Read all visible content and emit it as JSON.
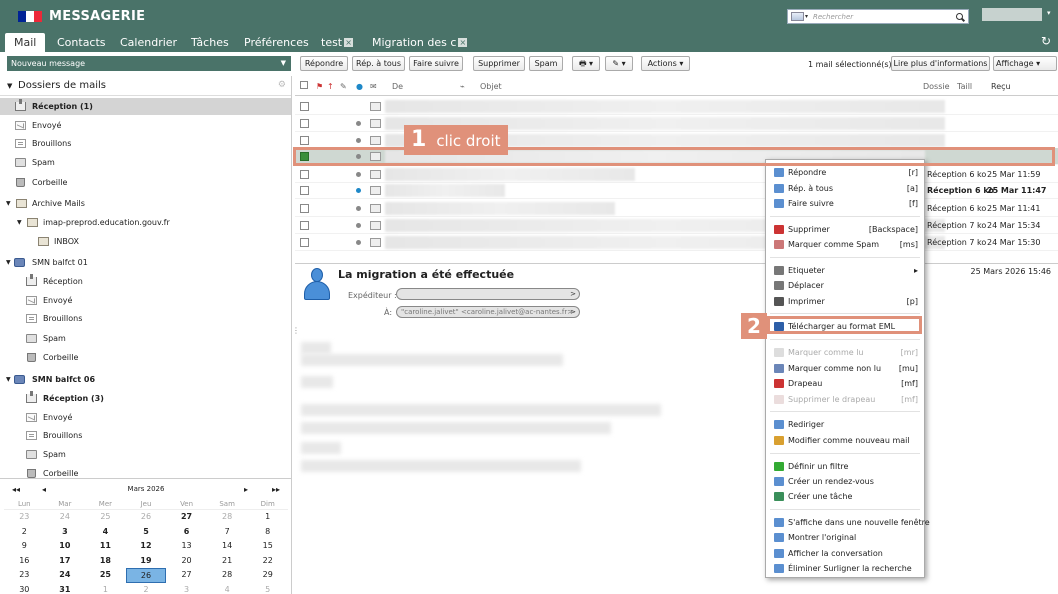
{
  "app": {
    "title": "MESSAGERIE",
    "flag_colors": [
      "#002395",
      "#ffffff",
      "#ed2939"
    ]
  },
  "search": {
    "placeholder": "Rechercher"
  },
  "tabs": [
    {
      "label": "Mail"
    },
    {
      "label": "Contacts"
    },
    {
      "label": "Calendrier"
    },
    {
      "label": "Tâches"
    },
    {
      "label": "Préférences"
    },
    {
      "label": "test"
    },
    {
      "label": "Migration des c"
    }
  ],
  "toolbar": {
    "new_message": "Nouveau message",
    "reply": "Répondre",
    "reply_all": "Rép. à tous",
    "forward": "Faire suivre",
    "delete": "Supprimer",
    "spam": "Spam",
    "actions": "Actions",
    "selection_info": "1 mail sélectionné(s)",
    "read_more": "Lire plus d'informations",
    "display": "Affichage"
  },
  "folders": {
    "title": "Dossiers de mails",
    "items": [
      {
        "label": "Réception (1)",
        "icon": "inbox-icon"
      },
      {
        "label": "Envoyé",
        "icon": "sent-icon"
      },
      {
        "label": "Brouillons",
        "icon": "drafts-icon"
      },
      {
        "label": "Spam",
        "icon": "spam-icon"
      },
      {
        "label": "Corbeille",
        "icon": "trash-icon"
      },
      {
        "label": "Archive Mails",
        "icon": "archive-icon"
      },
      {
        "label": "imap-preprod.education.gouv.fr",
        "icon": "folder-icon"
      },
      {
        "label": "INBOX",
        "icon": "folder-icon"
      },
      {
        "label": "SMN balfct 01",
        "icon": "account-icon"
      },
      {
        "label": "Réception",
        "icon": "inbox-icon"
      },
      {
        "label": "Envoyé",
        "icon": "sent-icon"
      },
      {
        "label": "Brouillons",
        "icon": "drafts-icon"
      },
      {
        "label": "Spam",
        "icon": "spam-icon"
      },
      {
        "label": "Corbeille",
        "icon": "trash-icon"
      },
      {
        "label": "SMN balfct 06",
        "icon": "account-icon"
      },
      {
        "label": "Réception (3)",
        "icon": "inbox-icon"
      },
      {
        "label": "Envoyé",
        "icon": "sent-icon"
      },
      {
        "label": "Brouillons",
        "icon": "drafts-icon"
      },
      {
        "label": "Spam",
        "icon": "spam-icon"
      },
      {
        "label": "Corbeille",
        "icon": "trash-icon"
      }
    ]
  },
  "calendar": {
    "month": "Mars 2026",
    "days": [
      "Lun",
      "Mar",
      "Mer",
      "Jeu",
      "Ven",
      "Sam",
      "Dim"
    ],
    "weeks": [
      [
        "23",
        "24",
        "25",
        "26",
        "27",
        "28",
        "1"
      ],
      [
        "2",
        "3",
        "4",
        "5",
        "6",
        "7",
        "8"
      ],
      [
        "9",
        "10",
        "11",
        "12",
        "13",
        "14",
        "15"
      ],
      [
        "16",
        "17",
        "18",
        "19",
        "20",
        "21",
        "22"
      ],
      [
        "23",
        "24",
        "25",
        "26",
        "27",
        "28",
        "29"
      ],
      [
        "30",
        "31",
        "1",
        "2",
        "3",
        "4",
        "5"
      ]
    ],
    "today": "26"
  },
  "list": {
    "columns": {
      "from": "De",
      "subject": "Objet",
      "folder": "Dossie",
      "size": "Taill",
      "received": "Reçu"
    },
    "rows": [
      {
        "size": "",
        "date": ""
      },
      {
        "size": "",
        "date": ""
      },
      {
        "size": "",
        "date": ""
      },
      {
        "size": "",
        "date": ""
      },
      {
        "size": "Réception 6 ko",
        "date": "25 Mar 11:59"
      },
      {
        "size": "Réception 6 ko",
        "date": "25 Mar 11:47"
      },
      {
        "size": "Réception 6 ko",
        "date": "25 Mar 11:41"
      },
      {
        "size": "Réception 7 ko",
        "date": "24 Mar 15:34"
      },
      {
        "size": "Réception 7 ko",
        "date": "24 Mar 15:30"
      }
    ]
  },
  "message": {
    "subject": "La migration a été effectuée",
    "date": "25 Mars 2026 15:46",
    "from_label": "Expéditeur :",
    "to_label": "À:",
    "to_value": "\"caroline.jalivet\" <caroline.jalivet@ac-nantes.fr>"
  },
  "context_menu": {
    "items": [
      {
        "label": "Répondre",
        "key": "[r]"
      },
      {
        "label": "Rép. à tous",
        "key": "[a]"
      },
      {
        "label": "Faire suivre",
        "key": "[f]"
      },
      {
        "label": "Supprimer",
        "key": "[Backspace]"
      },
      {
        "label": "Marquer comme Spam",
        "key": "[ms]"
      },
      {
        "label": "Etiqueter",
        "key": "▸"
      },
      {
        "label": "Déplacer",
        "key": ""
      },
      {
        "label": "Imprimer",
        "key": "[p]"
      },
      {
        "label": "Télécharger au format EML",
        "key": ""
      },
      {
        "label": "Marquer comme lu",
        "key": "[mr]"
      },
      {
        "label": "Marquer comme non lu",
        "key": "[mu]"
      },
      {
        "label": "Drapeau",
        "key": "[mf]"
      },
      {
        "label": "Supprimer le drapeau",
        "key": "[mf]"
      },
      {
        "label": "Rediriger",
        "key": ""
      },
      {
        "label": "Modifier comme nouveau mail",
        "key": ""
      },
      {
        "label": "Définir un filtre",
        "key": ""
      },
      {
        "label": "Créer un rendez-vous",
        "key": ""
      },
      {
        "label": "Créer une tâche",
        "key": ""
      },
      {
        "label": "S'affiche dans une nouvelle fenêtre",
        "key": ""
      },
      {
        "label": "Montrer l'original",
        "key": ""
      },
      {
        "label": "Afficher la conversation",
        "key": ""
      },
      {
        "label": "Éliminer Surligner la recherche",
        "key": ""
      }
    ]
  },
  "annotations": {
    "step1_num": "1",
    "step1_text": "clic droit",
    "step2_num": "2",
    "color": "#e0917a"
  }
}
